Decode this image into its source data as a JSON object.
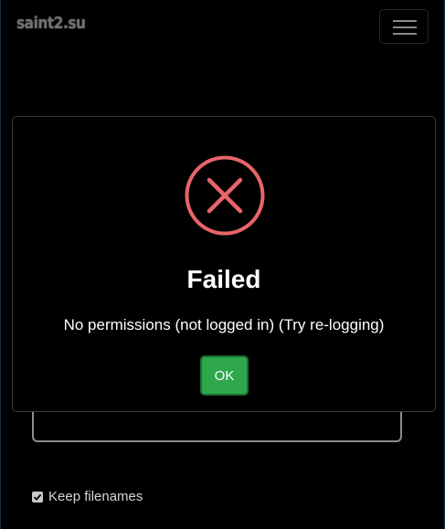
{
  "navbar": {
    "brand": "saint2.su",
    "menu_icon": "hamburger-menu-icon"
  },
  "form": {
    "keep_filenames_label": "Keep filenames",
    "keep_filenames_checked": true
  },
  "dialog": {
    "icon": "error-x-icon",
    "title": "Failed",
    "message": "No permissions (not logged in) (Try re-logging)",
    "ok_label": "OK"
  },
  "colors": {
    "background": "#000000",
    "error_icon": "#e8656b",
    "ok_button": "#2ea84b",
    "brand_text": "#6f6f6f"
  }
}
